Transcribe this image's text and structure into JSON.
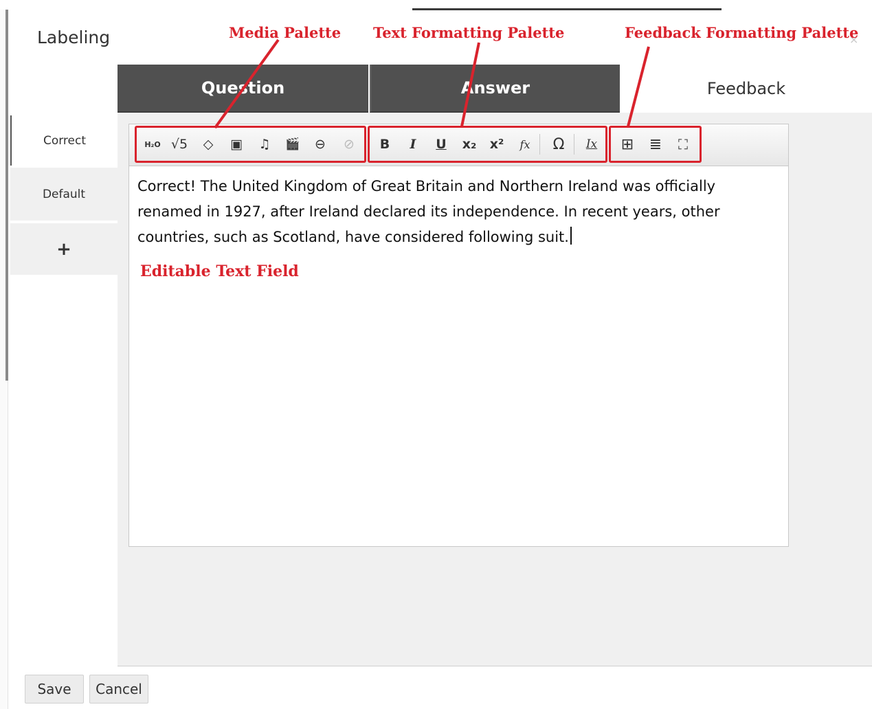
{
  "dialog": {
    "title": "Labeling",
    "close_glyph": "×"
  },
  "tabs": [
    {
      "label": "Question"
    },
    {
      "label": "Answer"
    },
    {
      "label": "Feedback"
    }
  ],
  "side_nav": {
    "items": [
      {
        "label": "Correct"
      },
      {
        "label": "Default"
      },
      {
        "label": "+"
      }
    ]
  },
  "toolbar": {
    "media": [
      {
        "icon": "chemistry-icon",
        "glyph": "H₂O"
      },
      {
        "icon": "square-root-icon",
        "glyph": "√5"
      },
      {
        "icon": "paint-bucket-icon",
        "glyph": "◇"
      },
      {
        "icon": "image-icon",
        "glyph": "▣"
      },
      {
        "icon": "audio-icon",
        "glyph": "♫"
      },
      {
        "icon": "video-icon",
        "glyph": "🎬"
      },
      {
        "icon": "link-icon",
        "glyph": "⊖"
      },
      {
        "icon": "unlink-icon",
        "glyph": "⊘"
      }
    ],
    "text": [
      {
        "icon": "bold-icon",
        "glyph": "B"
      },
      {
        "icon": "italic-icon",
        "glyph": "I"
      },
      {
        "icon": "underline-icon",
        "glyph": "U"
      },
      {
        "icon": "subscript-icon",
        "glyph": "x₂"
      },
      {
        "icon": "superscript-icon",
        "glyph": "x²"
      },
      {
        "icon": "formula-icon",
        "glyph": "fx"
      },
      {
        "icon": "special-char-icon",
        "glyph": "Ω"
      },
      {
        "icon": "remove-format-icon",
        "glyph": "Ix"
      }
    ],
    "feedback": [
      {
        "icon": "table-icon",
        "glyph": "⊞"
      },
      {
        "icon": "horizontal-rule-icon",
        "glyph": "≣"
      },
      {
        "icon": "maximize-icon",
        "glyph": "⛶"
      }
    ]
  },
  "editor": {
    "content": "Correct! The United Kingdom of Great Britain and Northern Ireland was officially renamed in 1927, after Ireland declared its independence. In recent years, other countries, such as Scotland, have considered following suit."
  },
  "annotations": {
    "media": "Media Palette",
    "text": "Text Formatting Palette",
    "feedback": "Feedback Formatting Palette",
    "editable": "Editable Text Field"
  },
  "colors": {
    "annotation": "#d9232d",
    "tab_dark": "#505050"
  },
  "footer": {
    "save_label": "Save",
    "cancel_label": "Cancel"
  }
}
